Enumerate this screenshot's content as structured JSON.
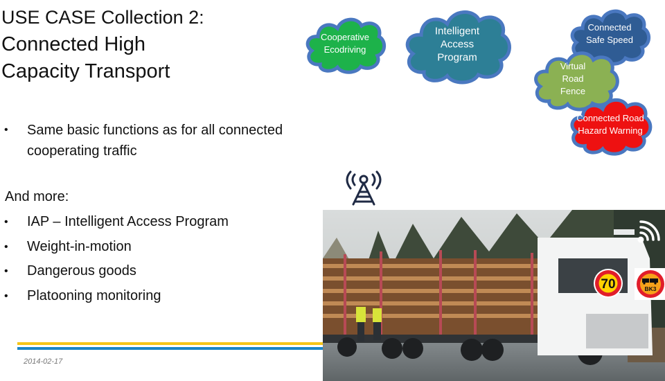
{
  "slide": {
    "title_lines": [
      "USE CASE Collection 2:",
      "Connected High",
      "Capacity Transport"
    ],
    "bullets_top": [
      "Same basic functions as for all connected cooperating traffic"
    ],
    "and_more_label": "And more:",
    "bullets_more": [
      "IAP – Intelligent Access Program",
      "Weight-in-motion",
      "Dangerous goods",
      "Platooning monitoring"
    ],
    "bullet_glyph": "•",
    "date": "2014-02-17"
  },
  "clouds": [
    {
      "id": "cooperative-ecodriving",
      "label": "Cooperative Ecodriving",
      "color": "#1db24a"
    },
    {
      "id": "intelligent-access-program",
      "label": "Intelligent Access Program",
      "color": "#2d7f96"
    },
    {
      "id": "connected-safe-speed",
      "label": "Connected Safe Speed",
      "color": "#2f5c94"
    },
    {
      "id": "virtual-road-fence",
      "label": "Virtual Road Fence",
      "color": "#8bb153"
    },
    {
      "id": "connected-road-hazard-warning",
      "label": "Connected Road Hazard Warning",
      "color": "#ee1111"
    }
  ],
  "photo": {
    "description": "Timber truck with trailers loaded with logs",
    "speed_sign": "70",
    "bk_sign": "BK3",
    "icons": [
      "radio-tower-icon",
      "wireless-signal-icon"
    ]
  },
  "colors": {
    "rule_yellow": "#f5c518",
    "rule_blue": "#1a86c8",
    "cloud_outline": "#4a78c0"
  }
}
